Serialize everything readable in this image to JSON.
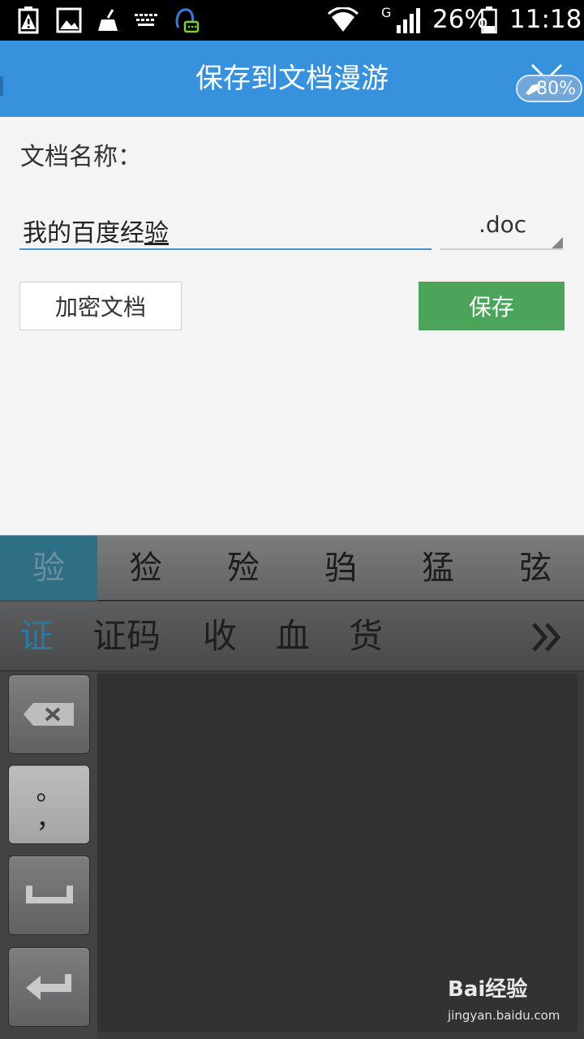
{
  "status_bar": {
    "battery_percent": "26%",
    "time": "11:18",
    "network_type": "G",
    "icons": [
      "battery-warning-icon",
      "image-icon",
      "broom-icon",
      "keyboard-icon",
      "qq-message-icon",
      "wifi-icon",
      "signal-icon",
      "battery-icon"
    ]
  },
  "header": {
    "title": "保存到文档漫游",
    "close_icon": "close-icon",
    "float_badge": "80%"
  },
  "form": {
    "name_label": "文档名称：",
    "name_value_committed": "我的百度经",
    "name_value_composing": "验",
    "extension": ".doc",
    "encrypt_button": "加密文档",
    "save_button": "保存"
  },
  "keyboard": {
    "candidates": [
      "验",
      "猃",
      "殓",
      "驺",
      "猛",
      "弦"
    ],
    "selected_candidate_index": 0,
    "suggestions": [
      "证",
      "证码",
      "收",
      "血",
      "货"
    ],
    "punct_top": "。",
    "punct_bottom": "，"
  },
  "watermark": {
    "logo": "Bai经验",
    "url": "jingyan.baidu.com"
  },
  "colors": {
    "header_bg": "#3891dd",
    "save_bg": "#4ca45a",
    "selected_candidate_bg": "#2f6f86"
  }
}
